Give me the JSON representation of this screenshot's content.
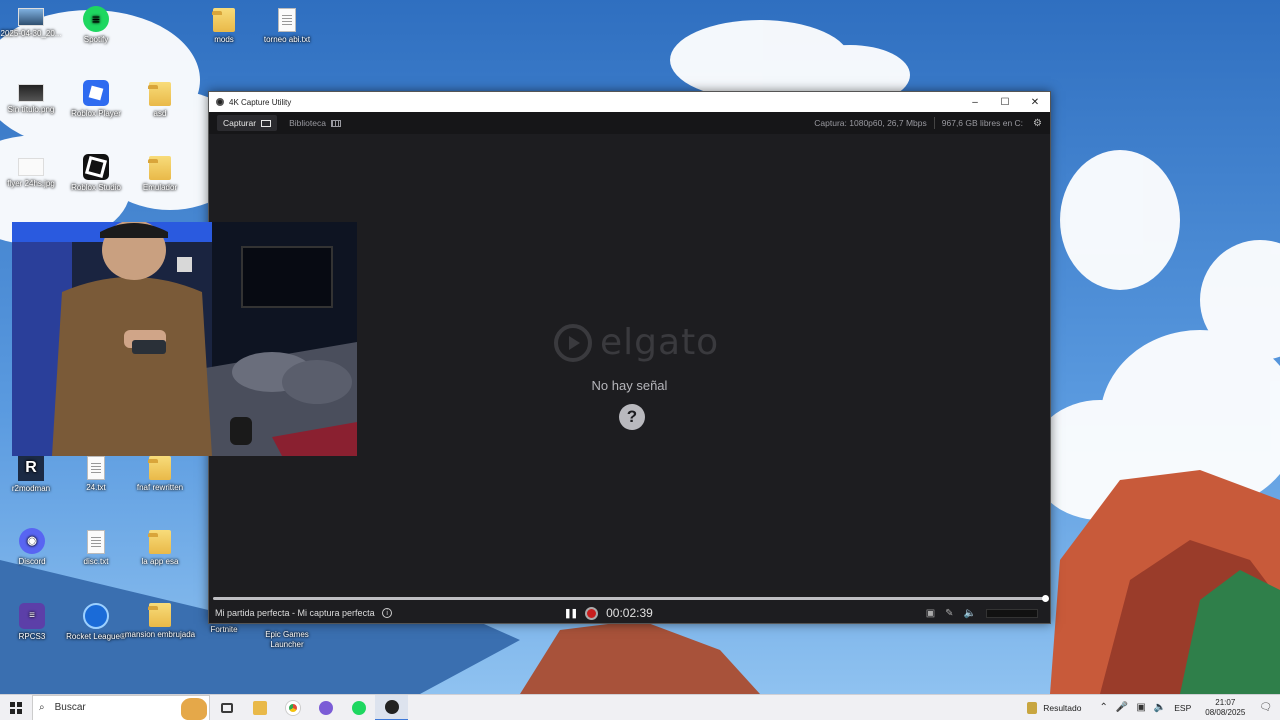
{
  "desktop": {
    "icons": [
      {
        "label": "2025-04-30_20...",
        "kind": "img"
      },
      {
        "label": "Spotify",
        "kind": "spotify"
      },
      {
        "label": "mods",
        "kind": "folder"
      },
      {
        "label": "torneo abi.txt",
        "kind": "txt"
      },
      {
        "label": "Sin título.png",
        "kind": "img"
      },
      {
        "label": "Roblox Player",
        "kind": "roblox"
      },
      {
        "label": "asd",
        "kind": "folder"
      },
      {
        "label": "flyer 24hs.jpg",
        "kind": "img"
      },
      {
        "label": "Roblox Studio",
        "kind": "studio"
      },
      {
        "label": "Emulador",
        "kind": "folder"
      },
      {
        "label": "r2modman",
        "kind": "r2"
      },
      {
        "label": "24.txt",
        "kind": "txt"
      },
      {
        "label": "fnaf rewritten",
        "kind": "folder"
      },
      {
        "label": "Discord",
        "kind": "discord"
      },
      {
        "label": "disc.txt",
        "kind": "txt"
      },
      {
        "label": "la app esa",
        "kind": "folder"
      },
      {
        "label": "RPCS3",
        "kind": "rpcs3"
      },
      {
        "label": "Rocket League®",
        "kind": "rl"
      },
      {
        "label": "mansion embrujada",
        "kind": "folder"
      },
      {
        "label": "Fortnite",
        "kind": "folder"
      },
      {
        "label": "Epic Games Launcher",
        "kind": "folder"
      }
    ]
  },
  "window": {
    "title": "4K Capture Utility",
    "minimize_glyph": "–",
    "maximize_glyph": "☐",
    "close_glyph": "✕",
    "tabs": [
      {
        "label": "Capturar",
        "active": true
      },
      {
        "label": "Biblioteca",
        "active": false
      }
    ],
    "capture_info": "Captura: 1080p60, 26,7 Mbps",
    "storage_info": "967,6 GB libres en C:",
    "logo_text": "elgato",
    "no_signal": "No hay señal",
    "help_glyph": "?",
    "progress": 1.0,
    "clip_title": "Mi partida perfecta - Mi captura perfecta",
    "info_glyph": "i",
    "timer": "00:02:39",
    "pause_glyph": "❚❚"
  },
  "taskbar": {
    "search_placeholder": "Buscar",
    "weather_label": "Resultado",
    "language": "ESP",
    "time": "21:07",
    "date": "08/08/2025",
    "apps": [
      {
        "name": "task-view",
        "color": "#3a3a3a"
      },
      {
        "name": "file-explorer",
        "color": "#e9b949"
      },
      {
        "name": "chrome",
        "color": "#e04a3a"
      },
      {
        "name": "discord-ptb",
        "color": "#7b5cd6"
      },
      {
        "name": "spotify",
        "color": "#1ed760"
      },
      {
        "name": "4k-capture",
        "color": "#222222"
      }
    ]
  },
  "colors": {
    "window_bg": "#1d1d20",
    "record_red": "#c81e1e",
    "taskbar_bg": "#f0f0f3"
  }
}
